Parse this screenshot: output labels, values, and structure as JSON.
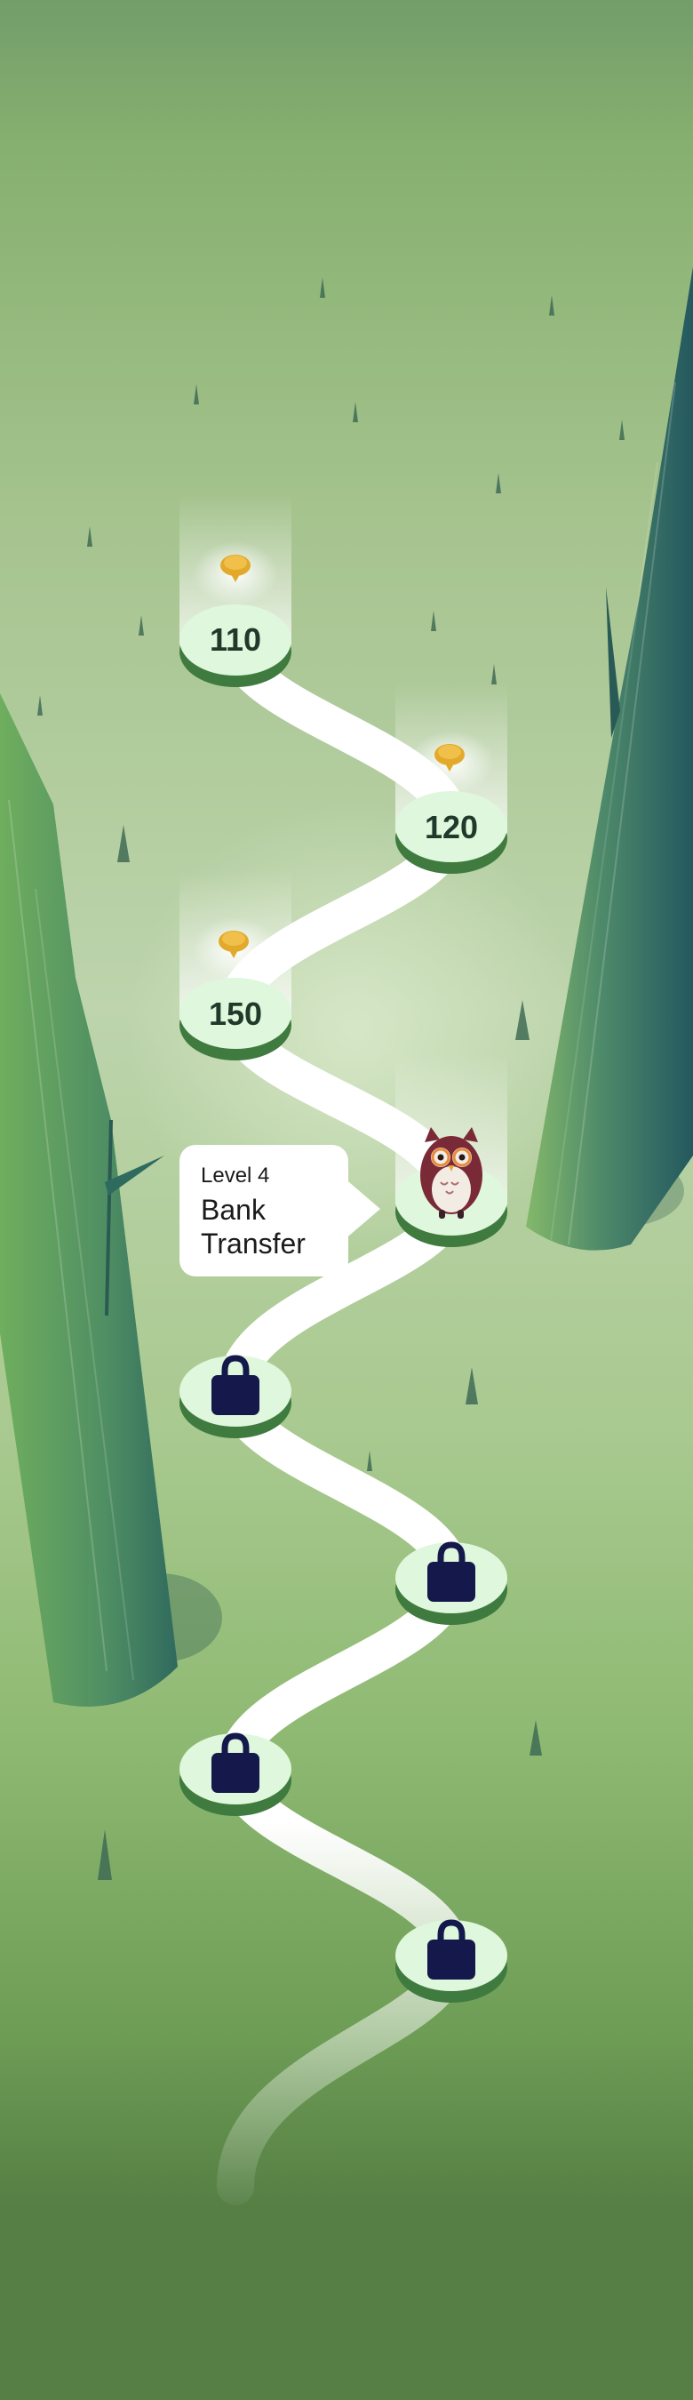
{
  "map": {
    "nodes": [
      {
        "id": "node-110",
        "label": "110",
        "state": "completed",
        "reward_icon": "coin-icon"
      },
      {
        "id": "node-120",
        "label": "120",
        "state": "completed",
        "reward_icon": "coin-icon"
      },
      {
        "id": "node-150",
        "label": "150",
        "state": "completed",
        "reward_icon": "coin-icon"
      },
      {
        "id": "node-current",
        "label": "",
        "state": "current",
        "avatar_icon": "owl-icon"
      },
      {
        "id": "node-locked-1",
        "label": "",
        "state": "locked",
        "icon": "lock-icon"
      },
      {
        "id": "node-locked-2",
        "label": "",
        "state": "locked",
        "icon": "lock-icon"
      },
      {
        "id": "node-locked-3",
        "label": "",
        "state": "locked",
        "icon": "lock-icon"
      },
      {
        "id": "node-locked-4",
        "label": "",
        "state": "locked",
        "icon": "lock-icon"
      }
    ],
    "tooltip": {
      "level": "Level 4",
      "name": "Bank Transfer"
    }
  },
  "colors": {
    "node_face": "#dff7dc",
    "node_rim": "#3f7a3f",
    "path": "#ffffff",
    "lock": "#14184a",
    "coin": "#e3a92b",
    "label": "#1f3a2a",
    "owl": "#7a2a36"
  }
}
